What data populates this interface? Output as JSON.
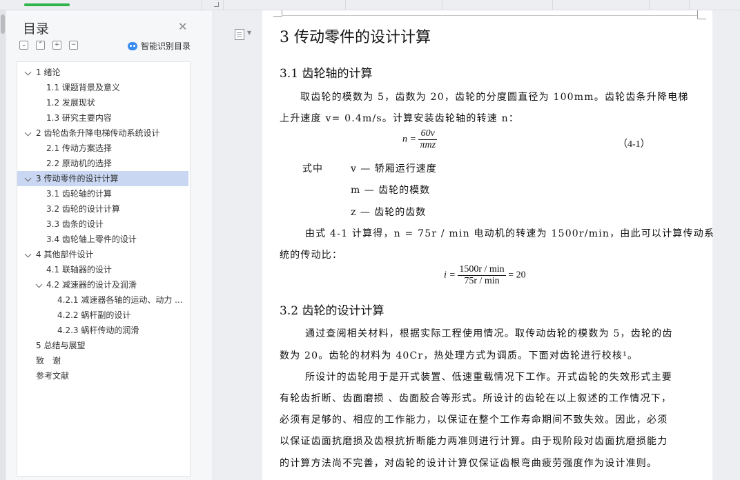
{
  "toc": {
    "title": "目录",
    "close_icon": "close-icon",
    "smart_label": "智能识别目录",
    "toolbar_buttons": [
      "⌄",
      "⌃",
      "+",
      "−"
    ],
    "items": [
      {
        "label": "1 绪论",
        "level": 1,
        "expanded": true
      },
      {
        "label": "1.1 课题背景及意义",
        "level": 2
      },
      {
        "label": "1.2 发展现状",
        "level": 2
      },
      {
        "label": "1.3 研究主要内容",
        "level": 2
      },
      {
        "label": "2 齿轮齿条升降电梯传动系统设计",
        "level": 1,
        "expanded": true
      },
      {
        "label": "2.1 传动方案选择",
        "level": 2
      },
      {
        "label": "2.2 原动机的选择",
        "level": 2
      },
      {
        "label": "3 传动零件的设计计算",
        "level": 1,
        "expanded": true,
        "active": true
      },
      {
        "label": "3.1 齿轮轴的计算",
        "level": 2
      },
      {
        "label": "3.2 齿轮的设计计算",
        "level": 2
      },
      {
        "label": "3.3 齿条的设计",
        "level": 2
      },
      {
        "label": "3.4 齿轮轴上零件的设计",
        "level": 2
      },
      {
        "label": "4 其他部件设计",
        "level": 1,
        "expanded": true
      },
      {
        "label": "4.1 联轴器的设计",
        "level": 2
      },
      {
        "label": "4.2 减速器的设计及润滑",
        "level": 2,
        "expanded": true
      },
      {
        "label": "4.2.1 减速器各轴的运动、动力 ...",
        "level": 3
      },
      {
        "label": "4.2.2 蜗杆副的设计",
        "level": 3
      },
      {
        "label": "4.2.3 蜗杆传动的润滑",
        "level": 3
      },
      {
        "label": "5 总结与展望",
        "level": 1
      },
      {
        "label": "致　谢",
        "level": 1
      },
      {
        "label": "参考文献",
        "level": 1
      }
    ]
  },
  "doc": {
    "h1": "3 传动零件的设计计算",
    "s31_title": "3.1 齿轮轴的计算",
    "p1_line1": "取齿轮的模数为 5，齿数为 20，齿轮的分度圆直径为 100mm。齿轮齿条升降电梯",
    "p1_line2": "上升速度 v= 0.4m/s。计算安装齿轮轴的转速 n：",
    "f1_lhs": "n =",
    "f1_num": "60v",
    "f1_den": "πmz",
    "f1_no": "（4-1）",
    "where_label": "式中",
    "var_v": "v — 轿厢运行速度",
    "var_m": "m — 齿轮的模数",
    "var_z": "z — 齿轮的齿数",
    "p2_line1": "由式 4-1 计算得，n = 75r / min 电动机的转速为 1500r/min，由此可以计算传动系",
    "p2_line2": "统的传动比：",
    "f2_lhs": "i =",
    "f2_num": "1500r / min",
    "f2_den": "75r / min",
    "f2_rhs": "= 20",
    "s32_title": "3.2 齿轮的设计计算",
    "p3_line1": "通过查阅相关材料，根据实际工程使用情况。取传动齿轮的模数为 5，齿轮的齿",
    "p3_line2": "数为 20。齿轮的材料为 40Cr，热处理方式为调质。下面对齿轮进行校核¹。",
    "p4_line1": "所设计的齿轮用于是开式装置、低速重载情况下工作。开式齿轮的失效形式主要",
    "p4_line2": "有轮齿折断、齿面磨损 、齿面胶合等形式。所设计的齿轮在以上叙述的工作情况下，",
    "p4_line3": "必须有足够的、相应的工作能力，以保证在整个工作寿命期间不致失效。因此，必须",
    "p4_line4": "以保证齿面抗磨损及齿根抗折断能力两准则进行计算。由于现阶段对齿面抗磨损能力",
    "p4_line5": "的计算方法尚不完善，对齿轮的设计计算仅保证齿根弯曲疲劳强度作为设计准则。"
  }
}
